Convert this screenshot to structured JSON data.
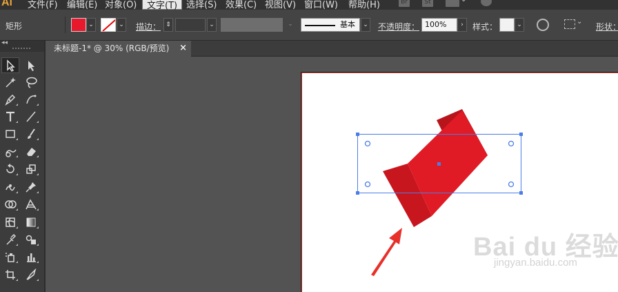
{
  "app": {
    "logo": "Ai"
  },
  "menu": [
    {
      "label": "文件(F)"
    },
    {
      "label": "编辑(E)"
    },
    {
      "label": "对象(O)"
    },
    {
      "label": "文字(T)",
      "active": true
    },
    {
      "label": "选择(S)"
    },
    {
      "label": "效果(C)"
    },
    {
      "label": "视图(V)"
    },
    {
      "label": "窗口(W)"
    },
    {
      "label": "帮助(H)"
    }
  ],
  "menu_right": {
    "bridge": "Br",
    "stock": "St"
  },
  "control": {
    "object_type": "矩形",
    "fill_color": "#e8192c",
    "stroke_label": "描边：",
    "stroke_value": "",
    "brush_label": "基本",
    "opacity_label": "不透明度：",
    "opacity_value": "100%",
    "style_label": "样式：",
    "shape_label": "形状："
  },
  "document": {
    "tab_title": "未标题-1* @ 30% (RGB/预览)",
    "close_glyph": "×"
  },
  "tools": [
    {
      "name": "selection-tool",
      "icon": "arrow-icon",
      "selected": true
    },
    {
      "name": "direct-selection-tool",
      "icon": "direct-arrow-icon"
    },
    {
      "name": "magic-wand-tool",
      "icon": "magic-wand-icon"
    },
    {
      "name": "lasso-tool",
      "icon": "lasso-icon"
    },
    {
      "name": "pen-tool",
      "icon": "pen-icon"
    },
    {
      "name": "curvature-tool",
      "icon": "curvature-icon"
    },
    {
      "name": "type-tool",
      "icon": "type-icon"
    },
    {
      "name": "line-tool",
      "icon": "line-icon"
    },
    {
      "name": "rectangle-tool",
      "icon": "rectangle-icon"
    },
    {
      "name": "paintbrush-tool",
      "icon": "brush-icon"
    },
    {
      "name": "shaper-tool",
      "icon": "shaper-icon"
    },
    {
      "name": "eraser-tool",
      "icon": "eraser-icon"
    },
    {
      "name": "rotate-tool",
      "icon": "rotate-icon"
    },
    {
      "name": "scale-tool",
      "icon": "scale-icon"
    },
    {
      "name": "warp-tool",
      "icon": "warp-icon"
    },
    {
      "name": "puppet-warp-tool",
      "icon": "pin-icon"
    },
    {
      "name": "shape-builder-tool",
      "icon": "shape-builder-icon"
    },
    {
      "name": "perspective-grid-tool",
      "icon": "perspective-icon"
    },
    {
      "name": "mesh-tool",
      "icon": "mesh-icon"
    },
    {
      "name": "gradient-tool",
      "icon": "gradient-icon"
    },
    {
      "name": "eyedropper-tool",
      "icon": "eyedropper-icon"
    },
    {
      "name": "blend-tool",
      "icon": "blend-icon"
    },
    {
      "name": "symbol-sprayer-tool",
      "icon": "symbol-sprayer-icon"
    },
    {
      "name": "column-graph-tool",
      "icon": "column-graph-icon"
    },
    {
      "name": "artboard-tool",
      "icon": "artboard-icon"
    },
    {
      "name": "slice-tool",
      "icon": "slice-icon"
    }
  ],
  "artwork": {
    "front_color": "#e01b25",
    "side_color": "#c8161f",
    "top_color": "#b8141c",
    "selection_color": "#4a7de8",
    "arrow_color": "#e8302a"
  },
  "watermark": {
    "main": "Bai du 经验",
    "sub": "jingyan.baidu.com"
  }
}
